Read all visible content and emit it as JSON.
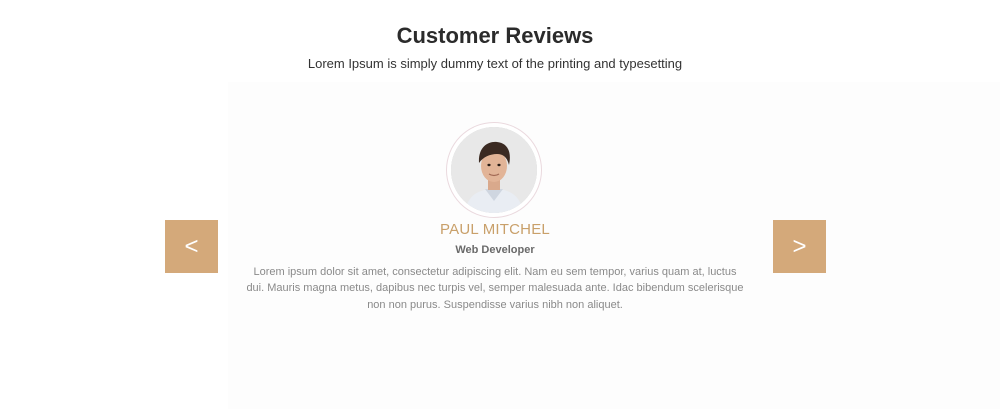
{
  "section": {
    "title": "Customer Reviews",
    "subtitle": "Lorem Ipsum is simply dummy text of the printing and typesetting"
  },
  "testimonial": {
    "name": "PAUL MITCHEL",
    "role": "Web Developer",
    "text": "Lorem ipsum dolor sit amet, consectetur adipiscing elit. Nam eu sem tempor, varius quam at, luctus dui. Mauris magna metus, dapibus nec turpis vel, semper malesuada ante. Idac bibendum scelerisque non non purus. Suspendisse varius nibh non aliquet."
  },
  "nav": {
    "prev_label": "<",
    "next_label": ">"
  },
  "colors": {
    "accent": "#d4a97a",
    "name": "#c9a06a",
    "title": "#2b2b2b"
  }
}
